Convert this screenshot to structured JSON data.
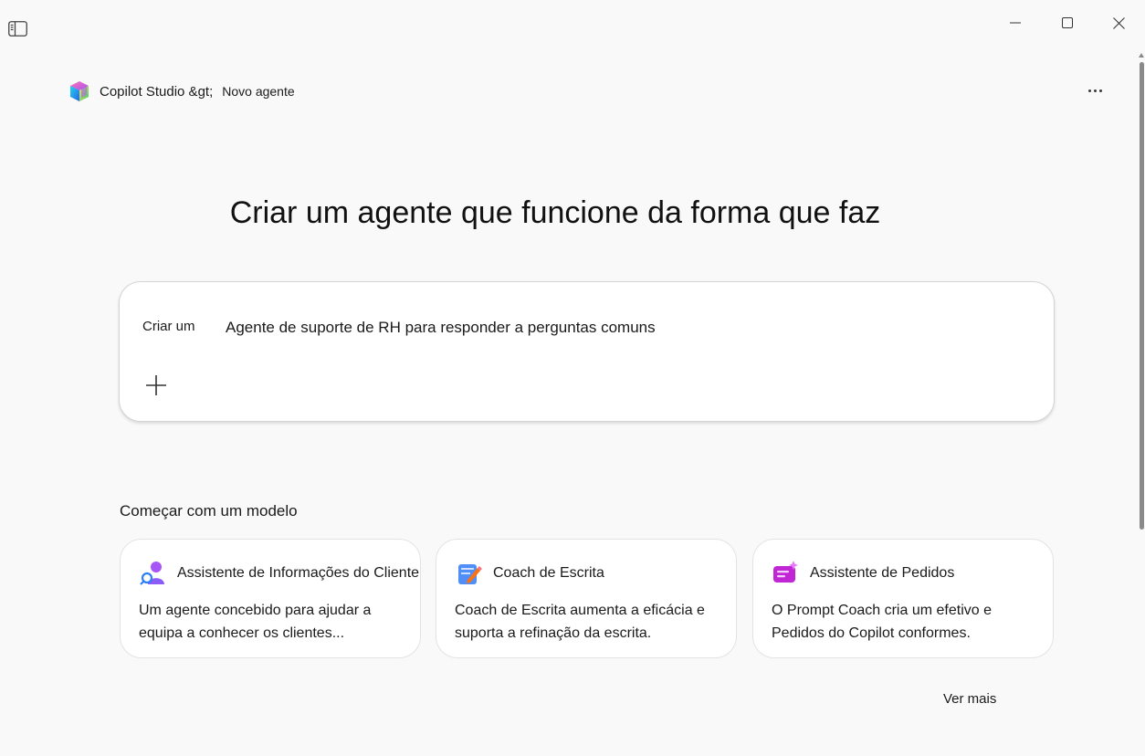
{
  "breadcrumb": {
    "app": "Copilot Studio &gt;",
    "current": "Novo agente"
  },
  "headline": "Criar um agente que funcione da forma que faz",
  "prompt": {
    "label": "Criar um",
    "value": "Agente de suporte de RH para responder a perguntas comuns"
  },
  "templates": {
    "title": "Começar com um modelo",
    "items": [
      {
        "title": "Assistente de Informações do Cliente",
        "description": "Um agente concebido para ajudar a equipa a conhecer os clientes...",
        "icon": "person-icon"
      },
      {
        "title": "Coach de Escrita",
        "description": "Coach de Escrita aumenta a eficácia e suporta a refinação da escrita.",
        "icon": "pen-notepad-icon"
      },
      {
        "title": "Assistente de Pedidos",
        "description": "O Prompt Coach cria um efetivo e Pedidos do Copilot conformes.",
        "icon": "ticket-sparkle-icon"
      }
    ],
    "see_more": "Ver mais"
  },
  "colors": {
    "background": "#f9f9f9",
    "card": "#ffffff",
    "accent_purple": "#8b5cf6",
    "accent_blue": "#2d7ff9",
    "accent_pink": "#d946ef"
  }
}
